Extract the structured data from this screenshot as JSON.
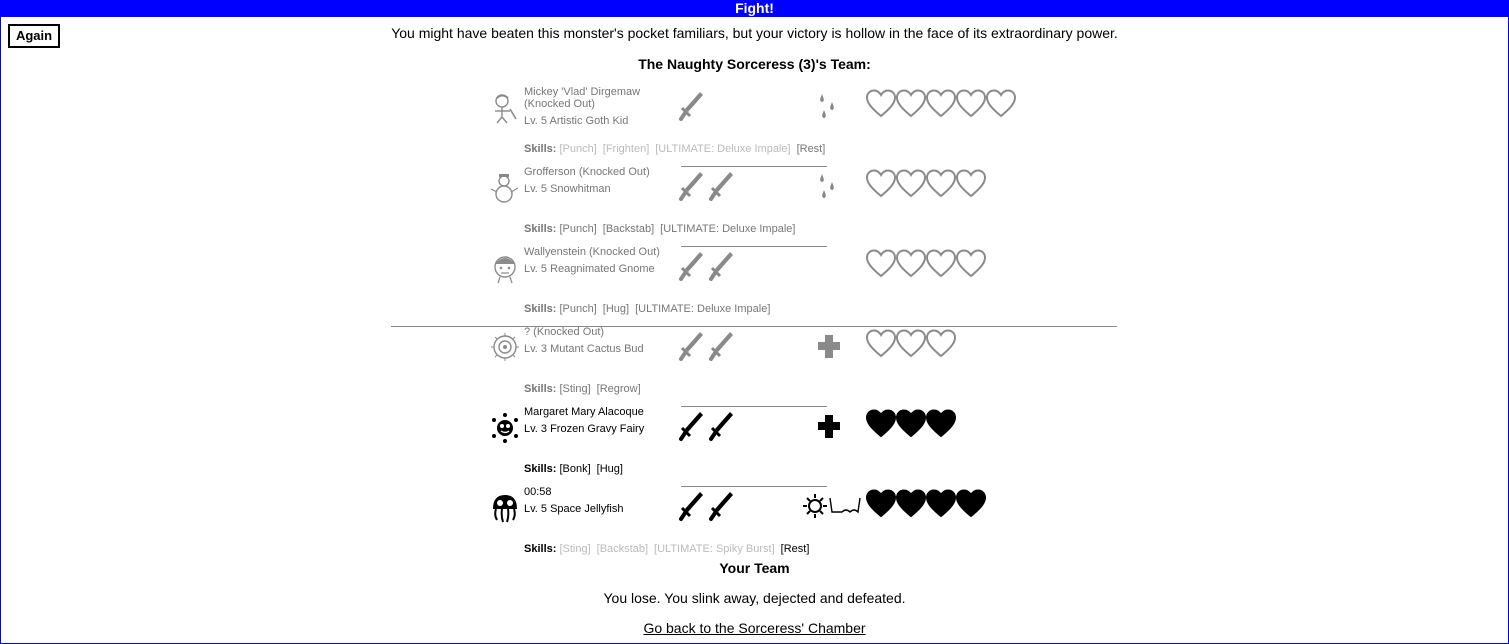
{
  "window": {
    "title": "Fight!"
  },
  "again_label": "Again",
  "result_message": "You might have beaten this monster's pocket familiars, but your victory is hollow in the face of its extraordinary power.",
  "enemy_team_title": "The Naughty Sorceress (3)'s Team:",
  "skills_label": "Skills:",
  "enemy_team": [
    {
      "name": "Mickey 'Vlad' Dirgemaw (Knocked Out)",
      "level": "Lv. 5 Artistic Goth Kid",
      "icon": "goth-kid-icon",
      "attack": 1,
      "effect": "drip-icon",
      "hearts_total": 5,
      "hearts_filled": 0,
      "skills": [
        {
          "label": "[Punch]",
          "dim": true
        },
        {
          "label": "[Frighten]",
          "dim": true
        },
        {
          "label": "[ULTIMATE: Deluxe Impale]",
          "dim": true
        },
        {
          "label": "[Rest]",
          "dim": false
        }
      ]
    },
    {
      "name": "Grofferson (Knocked Out)",
      "level": "Lv. 5 Snowhitman",
      "icon": "snowman-icon",
      "attack": 2,
      "effect": "drip-icon",
      "hearts_total": 4,
      "hearts_filled": 0,
      "skills": [
        {
          "label": "[Punch]",
          "dim": false
        },
        {
          "label": "[Backstab]",
          "dim": false
        },
        {
          "label": "[ULTIMATE: Deluxe Impale]",
          "dim": false
        }
      ]
    },
    {
      "name": "Wallyenstein (Knocked Out)",
      "level": "Lv. 5 Reagnimated Gnome",
      "icon": "gnome-icon",
      "attack": 2,
      "effect": "",
      "hearts_total": 4,
      "hearts_filled": 0,
      "skills": [
        {
          "label": "[Punch]",
          "dim": false
        },
        {
          "label": "[Hug]",
          "dim": false
        },
        {
          "label": "[ULTIMATE: Deluxe Impale]",
          "dim": false
        }
      ]
    }
  ],
  "your_team": [
    {
      "name": "? (Knocked Out)",
      "level": "Lv. 3 Mutant Cactus Bud",
      "icon": "cactus-bud-icon",
      "attack": 2,
      "effect": "cross-icon",
      "hearts_total": 3,
      "hearts_filled": 0,
      "ko": true,
      "skills": [
        {
          "label": "[Sting]",
          "dim": false
        },
        {
          "label": "[Regrow]",
          "dim": false
        }
      ]
    },
    {
      "name": "Margaret Mary Alacoque",
      "level": "Lv. 3 Frozen Gravy Fairy",
      "icon": "gravy-fairy-icon",
      "attack": 2,
      "effect": "cross-icon",
      "hearts_total": 3,
      "hearts_filled": 3,
      "ko": false,
      "skills": [
        {
          "label": "[Bonk]",
          "dim": false
        },
        {
          "label": "[Hug]",
          "dim": false
        }
      ]
    },
    {
      "name": "00:58",
      "level": "Lv. 5 Space Jellyfish",
      "icon": "space-jellyfish-icon",
      "attack": 2,
      "effect": "spiky-glasses-icon",
      "hearts_total": 4,
      "hearts_filled": 4,
      "ko": false,
      "skills": [
        {
          "label": "[Sting]",
          "dim": true
        },
        {
          "label": "[Backstab]",
          "dim": true
        },
        {
          "label": "[ULTIMATE: Spiky Burst]",
          "dim": true
        },
        {
          "label": "[Rest]",
          "dim": false
        }
      ]
    }
  ],
  "your_team_title": "Your Team",
  "lose_message": "You lose. You slink away, dejected and defeated.",
  "back_link": "Go back to the Sorceress' Chamber",
  "colors": {
    "titlebar": "#0000ff",
    "ko_text": "#777777",
    "dim_skill": "#bbbbbb"
  }
}
